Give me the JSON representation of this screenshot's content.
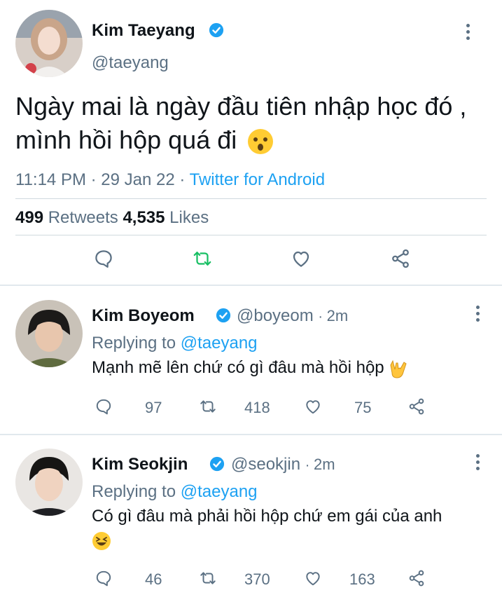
{
  "main_tweet": {
    "author_name": "Kim Taeyang",
    "handle": "@taeyang",
    "text": "Ngày mai là ngày đầu tiên nhập học đó , mình hồi hộp quá đi",
    "text_emoji": "hushed-face-emoji",
    "time": "11:14 PM",
    "date": "29 Jan 22",
    "source": "Twitter for Android",
    "retweets_count": "499",
    "retweets_label": "Retweets",
    "likes_count": "4,535",
    "likes_label": "Likes"
  },
  "replies": [
    {
      "author_name": "Kim Boyeom",
      "handle": "@boyeom",
      "age": "2m",
      "replying_label": "Replying to",
      "replying_to": "@taeyang",
      "text": "Mạnh mẽ lên chứ có gì đâu mà hồi hộp",
      "text_emoji": "love-you-gesture-emoji",
      "replies": "97",
      "retweets": "418",
      "likes": "75"
    },
    {
      "author_name": "Kim Seokjin",
      "handle": "@seokjin",
      "age": "2m",
      "replying_label": "Replying to",
      "replying_to": "@taeyang",
      "text": "Có gì đâu mà phải hồi hộp chứ em gái của anh",
      "text_emoji": "grinning-squinting-face-emoji",
      "replies": "46",
      "retweets": "370",
      "likes": "163"
    }
  ],
  "colors": {
    "link": "#1da1f2",
    "secondary_text": "#5b7083",
    "retweet_active": "#17bf63",
    "verified": "#1da1f2"
  }
}
